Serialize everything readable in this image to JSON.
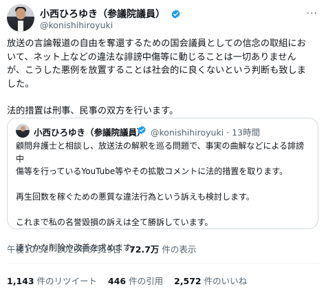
{
  "author": {
    "display_name": "小西ひろゆき（参議院議員）",
    "handle": "@konishihiroyuki",
    "verified_badge_color": "#1d9bf0"
  },
  "tweet": {
    "lines": [
      "放送の言論報道の自由を奪還するための国会議員としての信念の取組にお",
      "いて、ネット上などの違法な誹謗中傷等に動じることは一切ありません",
      "が、こうした悪例を放置することは社会的に良くないという判断も致しま",
      "した。",
      "",
      "法的措置は刑事、民事の双方を行います。"
    ]
  },
  "quoted_tweet": {
    "display_name": "小西ひろゆき（参議院議員）",
    "meta": "@konishihiroyuki · 13時間",
    "lines": [
      "顧問弁護士と相談し、放送法の解釈を巡る問題で、事実の曲解などによる誹謗中",
      "傷等を行っているYouTube等やその拡散コメントに法的措置を取ります。",
      "",
      "再生回数を稼ぐための悪質な違法行為という訴えも検討します。",
      "",
      "これまで私の名誉毀損の訴えは全て勝訴しています。",
      "",
      "速やかな削除や改善を求めます。"
    ]
  },
  "meta": {
    "time": "午後10:52 · 2023年3月19日 · ",
    "views_count": "72.7万",
    "views_label": " 件の表示"
  },
  "stats": {
    "retweets_count": "1,143",
    "retweets_label": " 件のリツイート",
    "quotes_count": "446",
    "quotes_label": " 件の引用",
    "likes_count": "2,572",
    "likes_label": " 件のいいね"
  }
}
